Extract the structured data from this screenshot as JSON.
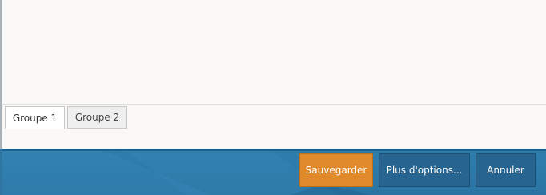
{
  "tabs": [
    {
      "label": "Groupe 1",
      "active": true
    },
    {
      "label": "Groupe 2",
      "active": false
    }
  ],
  "footer": {
    "save_label": "Sauvegarder",
    "more_label": "Plus d'options...",
    "cancel_label": "Annuler"
  },
  "colors": {
    "footer_bg": "#2e7fae",
    "save_button": "#e08a2c",
    "secondary_button": "#27648f",
    "content_bg": "#faf9f7"
  }
}
